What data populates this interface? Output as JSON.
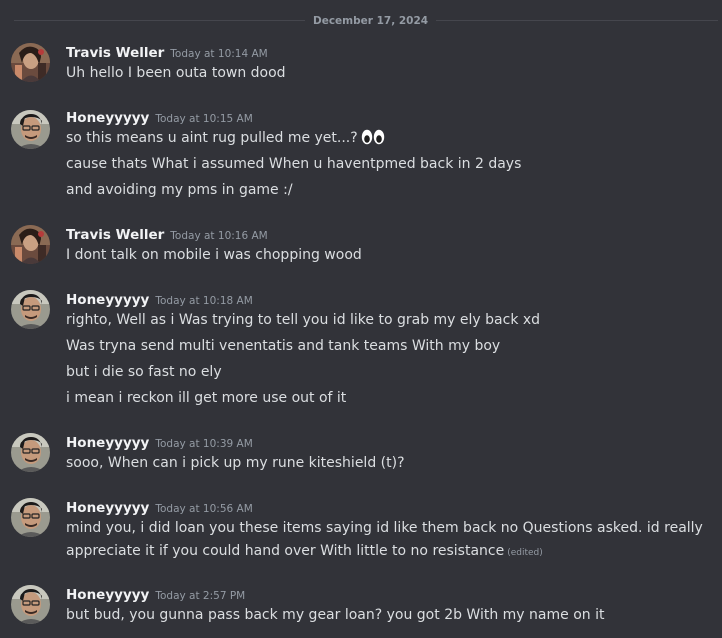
{
  "date_divider": "December 17, 2024",
  "messages": [
    {
      "author": "Travis Weller",
      "timestamp": "Today at 10:14 AM",
      "avatar": "travis-avatar",
      "lines": [
        "Uh hello I been outa town dood"
      ]
    },
    {
      "author": "Honeyyyyy",
      "timestamp": "Today at 10:15 AM",
      "avatar": "honey-avatar",
      "lines": [
        "so this means u aint rug pulled me yet...?",
        "cause thats What i assumed When u haventpmed back in 2 days",
        "and avoiding my pms in game :/"
      ],
      "emoji": "eyes-emoji"
    },
    {
      "author": "Travis Weller",
      "timestamp": "Today at 10:16 AM",
      "avatar": "travis-avatar",
      "lines": [
        "I dont talk on mobile i was chopping wood"
      ]
    },
    {
      "author": "Honeyyyyy",
      "timestamp": "Today at 10:18 AM",
      "avatar": "honey-avatar",
      "lines": [
        "righto, Well as i Was trying to tell you id like to grab my ely back xd",
        "Was tryna send multi venentatis and tank teams With my boy",
        "but i die so fast no ely",
        "i mean i reckon ill get more use out of it"
      ]
    },
    {
      "author": "Honeyyyyy",
      "timestamp": "Today at 10:39 AM",
      "avatar": "honey-avatar",
      "lines": [
        "sooo, When can i  pick up my rune kiteshield (t)?"
      ]
    },
    {
      "author": "Honeyyyyy",
      "timestamp": "Today at 10:56 AM",
      "avatar": "honey-avatar",
      "lines": [
        "mind you, i did loan you these items saying id like them back no Questions asked. id really",
        "appreciate it if you could hand over With little to no resistance"
      ],
      "edited_label": "(edited)"
    },
    {
      "author": "Honeyyyyy",
      "timestamp": "Today at 2:57 PM",
      "avatar": "honey-avatar",
      "lines": [
        "but bud, you gunna pass back my gear loan? you got 2b With my name on it"
      ]
    }
  ]
}
